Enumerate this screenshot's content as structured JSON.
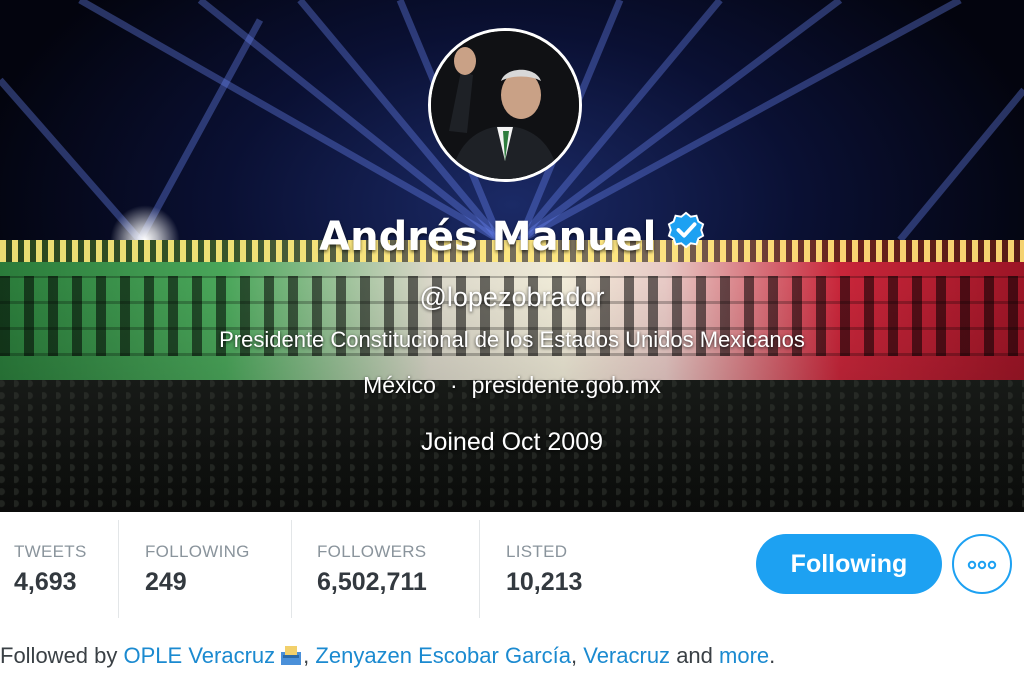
{
  "profile": {
    "display_name": "Andrés Manuel",
    "handle": "@lopezobrador",
    "bio": "Presidente Constitucional de los Estados Unidos Mexicanos",
    "location": "México",
    "separator": "·",
    "website": "presidente.gob.mx",
    "joined": "Joined Oct 2009",
    "verified": true
  },
  "stats": [
    {
      "label": "TWEETS",
      "value": "4,693"
    },
    {
      "label": "FOLLOWING",
      "value": "249"
    },
    {
      "label": "FOLLOWERS",
      "value": "6,502,711"
    },
    {
      "label": "LISTED",
      "value": "10,213"
    }
  ],
  "actions": {
    "follow_label": "Following",
    "more_icon": "ellipsis-icon"
  },
  "followed_by": {
    "prefix": "Followed by",
    "users": [
      "OPLE Veracruz",
      "Zenyazen Escobar García",
      "Veracruz"
    ],
    "sep1": ",",
    "sep2": ",",
    "and_text": "and",
    "more": "more",
    "end": "."
  },
  "colors": {
    "accent": "#1da1f2",
    "link": "#1b8ad0",
    "stat_label": "#8a949c",
    "stat_value": "#33393f"
  }
}
